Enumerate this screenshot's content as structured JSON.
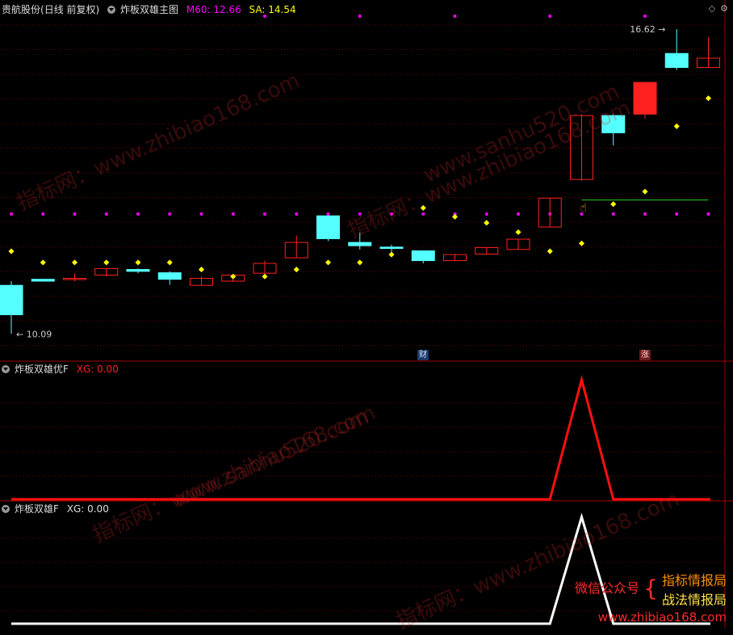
{
  "main_panel": {
    "stock_name": "贵航股份",
    "period": "(日线 前复权)",
    "indicator": "炸板双雄主图",
    "m60_label": "M60: 12.66",
    "sa_label": "SA: 14.54",
    "high_label": "16.62",
    "low_label": "10.09",
    "badge_cai": "财",
    "badge_zhang": "涨",
    "colors": {
      "up": "#ff2020",
      "down": "#54ffff",
      "m60": "#ff00ff",
      "sa": "#ffff00",
      "grid": "#6e0000"
    }
  },
  "sub_panel_1": {
    "indicator": "炸板双雄优F",
    "xg_label": "XG: 0.00",
    "line_color": "#ff1010"
  },
  "sub_panel_2": {
    "indicator": "炸板双雄F",
    "xg_label": "XG: 0.00",
    "line_color": "#ffffff"
  },
  "window_icons": {
    "diamond": "◇",
    "gear": "⚙"
  },
  "watermarks": [
    "指标网：www.zhibiao168.com",
    "www.sanhu520.com"
  ],
  "brand": {
    "wechat": "微信公众号",
    "line1": "指标情报局",
    "line2": "战法情报局",
    "url": "www.zhibiao168.com"
  },
  "chart_data": {
    "type": "candlestick",
    "price_range": [
      9.8,
      16.9
    ],
    "candles": [
      {
        "o": 11.13,
        "h": 11.22,
        "l": 10.09,
        "c": 10.5
      },
      {
        "o": 11.26,
        "h": 11.26,
        "l": 11.22,
        "c": 11.22
      },
      {
        "o": 11.28,
        "h": 11.38,
        "l": 11.22,
        "c": 11.28
      },
      {
        "o": 11.35,
        "h": 11.49,
        "l": 11.32,
        "c": 11.49
      },
      {
        "o": 11.47,
        "h": 11.49,
        "l": 11.39,
        "c": 11.43
      },
      {
        "o": 11.4,
        "h": 11.43,
        "l": 11.14,
        "c": 11.26
      },
      {
        "o": 11.13,
        "h": 11.32,
        "l": 11.13,
        "c": 11.28
      },
      {
        "o": 11.22,
        "h": 11.37,
        "l": 11.2,
        "c": 11.35
      },
      {
        "o": 11.39,
        "h": 11.66,
        "l": 11.39,
        "c": 11.6
      },
      {
        "o": 11.72,
        "h": 12.2,
        "l": 11.72,
        "c": 12.05
      },
      {
        "o": 12.62,
        "h": 12.62,
        "l": 12.08,
        "c": 12.13
      },
      {
        "o": 12.05,
        "h": 12.26,
        "l": 11.9,
        "c": 11.98
      },
      {
        "o": 11.95,
        "h": 12.0,
        "l": 11.8,
        "c": 11.92
      },
      {
        "o": 11.87,
        "h": 11.87,
        "l": 11.6,
        "c": 11.66
      },
      {
        "o": 11.66,
        "h": 11.8,
        "l": 11.66,
        "c": 11.79
      },
      {
        "o": 11.8,
        "h": 11.94,
        "l": 11.8,
        "c": 11.94
      },
      {
        "o": 11.9,
        "h": 12.12,
        "l": 11.9,
        "c": 12.12
      },
      {
        "o": 12.38,
        "h": 13.0,
        "l": 12.38,
        "c": 13.0
      },
      {
        "o": 13.4,
        "h": 14.8,
        "l": 13.37,
        "c": 14.77
      },
      {
        "o": 14.77,
        "h": 14.8,
        "l": 14.13,
        "c": 14.4
      },
      {
        "o": 14.8,
        "h": 15.48,
        "l": 14.7,
        "c": 15.48
      },
      {
        "o": 16.1,
        "h": 16.62,
        "l": 15.75,
        "c": 15.8
      },
      {
        "o": 15.8,
        "h": 16.45,
        "l": 15.8,
        "c": 16.0
      }
    ],
    "m60_level": 12.66,
    "sa_dots": [
      11.86,
      11.62,
      11.62,
      11.62,
      11.62,
      11.62,
      11.47,
      11.32,
      11.32,
      11.47,
      11.62,
      11.62,
      11.79,
      12.79,
      12.6,
      12.47,
      12.27,
      11.86,
      12.03,
      12.87,
      13.14,
      14.54,
      15.14
    ],
    "green_line": {
      "from_index": 18,
      "to_index": 22,
      "level": 12.96
    },
    "xg_series": [
      0,
      0,
      0,
      0,
      0,
      0,
      0,
      0,
      0,
      0,
      0,
      0,
      0,
      0,
      0,
      0,
      0,
      0,
      1,
      0,
      0,
      0,
      0
    ]
  }
}
